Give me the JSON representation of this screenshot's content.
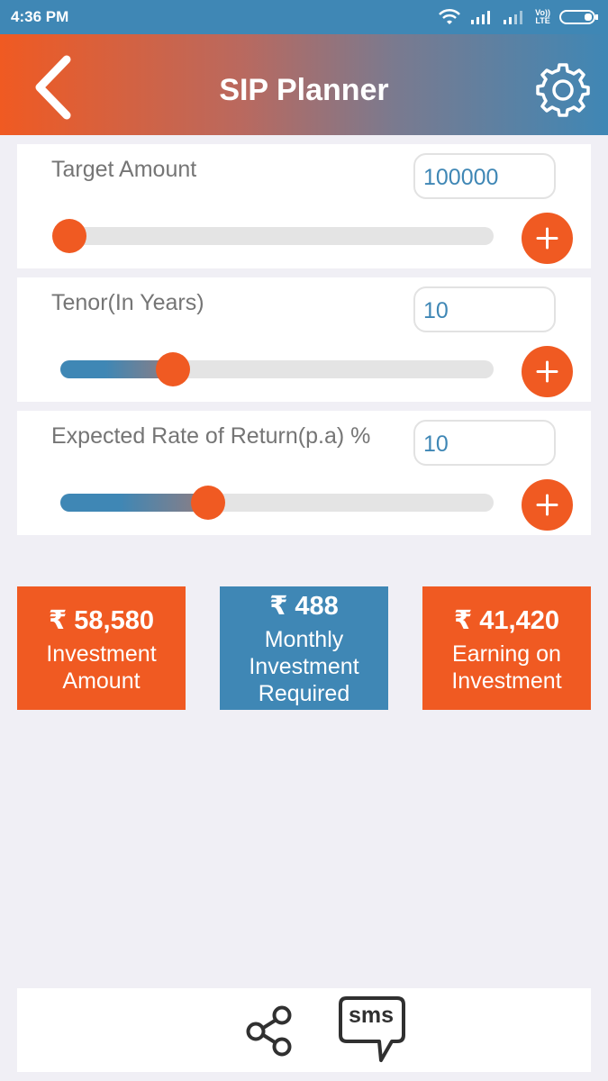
{
  "status_bar": {
    "time": "4:36 PM",
    "network_label": "Vo))\nLTE"
  },
  "header": {
    "title": "SIP Planner"
  },
  "inputs": [
    {
      "label": "Target Amount",
      "value": "100000",
      "slider_fraction": 0.0
    },
    {
      "label": "Tenor(In Years)",
      "value": "10",
      "slider_fraction": 0.25
    },
    {
      "label": "Expected Rate of Return(p.a) %",
      "value": "10",
      "slider_fraction": 0.335
    }
  ],
  "results": [
    {
      "value": "₹ 58,580",
      "label_lines": [
        "Investment",
        "Amount"
      ],
      "color": "#f05a22"
    },
    {
      "value": "₹ 488",
      "label_lines": [
        "Monthly",
        "Investment",
        "Required"
      ],
      "color": "#3f87b5"
    },
    {
      "value": "₹ 41,420",
      "label_lines": [
        "Earning on",
        "Investment"
      ],
      "color": "#f05a22"
    }
  ],
  "bottom_bar": {
    "sms_label": "sms"
  },
  "colors": {
    "accent_orange": "#f05a22",
    "accent_blue": "#3f87b5",
    "background": "#f0eff5"
  },
  "icons": [
    "back-icon",
    "gear-icon",
    "plus-icon",
    "share-icon",
    "sms-icon",
    "wifi-icon",
    "signal-icon",
    "battery-icon"
  ]
}
